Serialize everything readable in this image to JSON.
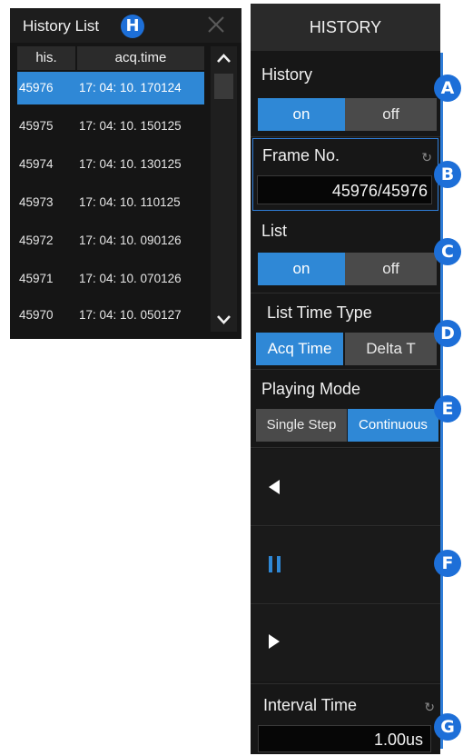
{
  "history_list": {
    "title": "History List",
    "badge": "H",
    "close_icon": "close-icon",
    "columns": [
      "his.",
      "acq.time"
    ],
    "rows": [
      {
        "his": "45976",
        "time": "17: 04: 10. 170124",
        "selected": true
      },
      {
        "his": "45975",
        "time": "17: 04: 10. 150125"
      },
      {
        "his": "45974",
        "time": "17: 04: 10. 130125"
      },
      {
        "his": "45973",
        "time": "17: 04: 10. 110125"
      },
      {
        "his": "45972",
        "time": "17: 04: 10. 090126"
      },
      {
        "his": "45971",
        "time": "17: 04: 10. 070126"
      },
      {
        "his": "45970",
        "time": "17: 04: 10. 050127"
      }
    ],
    "scroll_up_icon": "chevron-up-icon",
    "scroll_down_icon": "chevron-down-icon"
  },
  "menu": {
    "title": "HISTORY",
    "history": {
      "label": "History",
      "on": "on",
      "off": "off",
      "badge": "A",
      "state": "on"
    },
    "frame": {
      "label": "Frame No.",
      "value": "45976/45976",
      "badge": "B",
      "refresh_icon": "refresh-icon"
    },
    "list": {
      "label": "List",
      "on": "on",
      "off": "off",
      "badge": "C",
      "state": "on"
    },
    "list_time_type": {
      "label": "List Time Type",
      "opt1": "Acq Time",
      "opt2": "Delta T",
      "badge": "D",
      "selected": "Acq Time"
    },
    "playing_mode": {
      "label": "Playing Mode",
      "opt1": "Single Step",
      "opt2": "Continuous",
      "badge": "E",
      "selected": "Continuous"
    },
    "playback": {
      "badge": "F",
      "prev_icon": "play-backward-icon",
      "pause_icon": "pause-icon",
      "next_icon": "play-forward-icon"
    },
    "interval": {
      "label": "Interval Time",
      "value": "1.00us",
      "badge": "G",
      "refresh_icon": "refresh-icon"
    }
  },
  "colors": {
    "accent": "#2f88d6",
    "badge": "#1d6fd8",
    "panel": "#171717"
  }
}
